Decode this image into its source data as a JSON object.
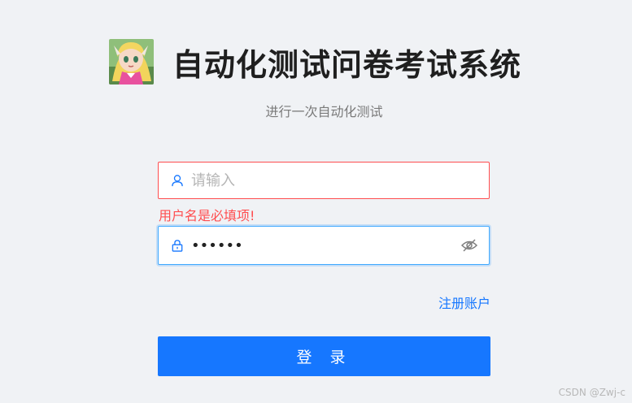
{
  "header": {
    "logo_icon": "avatar-logo-icon",
    "title": "自动化测试问卷考试系统",
    "subtitle": "进行一次自动化测试"
  },
  "form": {
    "username": {
      "placeholder": "请输入",
      "value": "",
      "icon": "user-icon",
      "error": "用户名是必填项!"
    },
    "password": {
      "value": "123456",
      "icon": "lock-icon",
      "toggle_icon": "eye-invisible-icon"
    },
    "register_label": "注册账户",
    "login_label": "登 录"
  },
  "watermark": "CSDN @Zwj-c",
  "colors": {
    "primary": "#1677ff",
    "error": "#ff4d4f",
    "background": "#f0f2f5"
  }
}
